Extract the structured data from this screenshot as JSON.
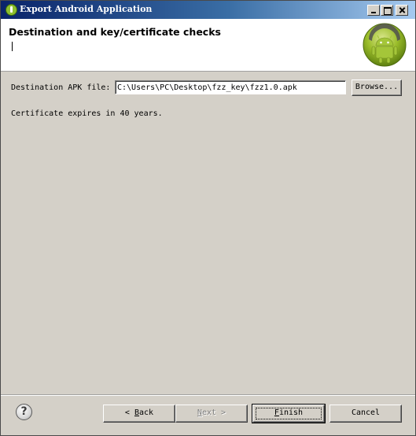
{
  "window": {
    "title": "Export Android Application",
    "controls": {
      "minimize": "minimize-icon",
      "maximize": "maximize-icon",
      "close": "close-icon"
    }
  },
  "header": {
    "title": "Destination and key/certificate checks",
    "description": "",
    "logo": "android-robot-icon"
  },
  "form": {
    "destination_label": "Destination APK file:",
    "destination_value": "C:\\Users\\PC\\Desktop\\fzz_key\\fzz1.0.apk",
    "browse_label": "Browse...",
    "certificate_message": "Certificate expires in 40 years."
  },
  "footer": {
    "help_icon": "help-icon",
    "help_glyph": "?",
    "back": {
      "prefix": "< ",
      "mnemonic": "B",
      "rest": "ack"
    },
    "next": {
      "mnemonic": "N",
      "rest": "ext >"
    },
    "finish": {
      "mnemonic": "F",
      "rest": "inish"
    },
    "cancel_label": "Cancel"
  },
  "colors": {
    "dialog_bg": "#d4d0c8",
    "titlebar_start": "#0a246a",
    "titlebar_end": "#a6caf0",
    "android_green": "#a4c639"
  }
}
